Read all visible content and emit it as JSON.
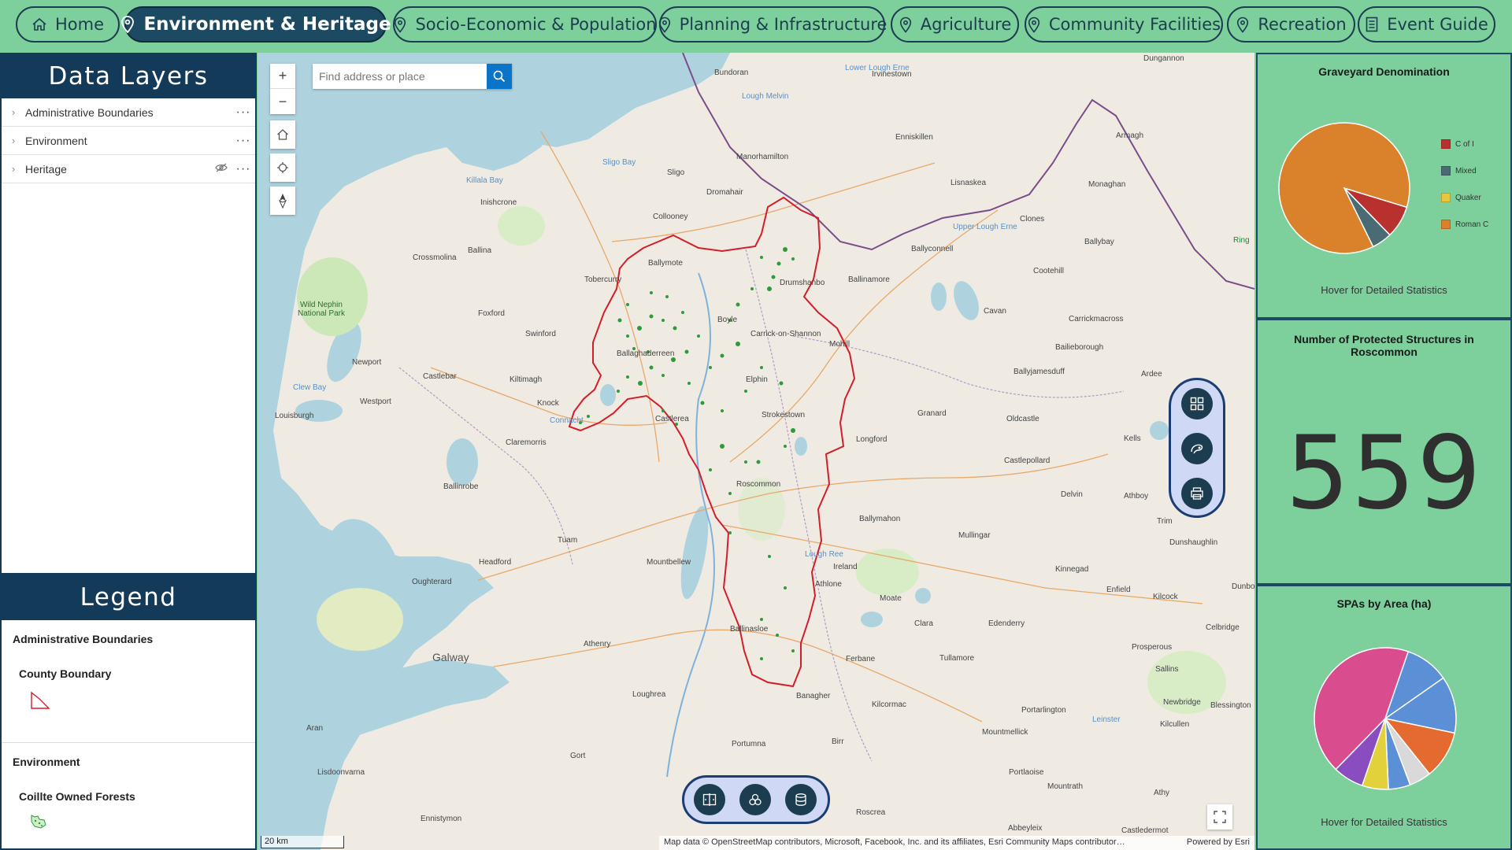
{
  "nav": {
    "tabs": [
      {
        "label": "Home",
        "icon": "home-icon",
        "active": false
      },
      {
        "label": "Environment & Heritage",
        "icon": "map-pin-icon",
        "active": true
      },
      {
        "label": "Socio-Economic & Population",
        "icon": "map-pin-icon",
        "active": false
      },
      {
        "label": "Planning & Infrastructure",
        "icon": "map-pin-icon",
        "active": false
      },
      {
        "label": "Agriculture",
        "icon": "map-pin-icon",
        "active": false
      },
      {
        "label": "Community Facilities",
        "icon": "map-pin-icon",
        "active": false
      },
      {
        "label": "Recreation",
        "icon": "map-pin-icon",
        "active": false
      },
      {
        "label": "Event Guide",
        "icon": "document-icon",
        "active": false
      }
    ]
  },
  "layers": {
    "title": "Data Layers",
    "items": [
      {
        "label": "Administrative Boundaries",
        "hidden": false
      },
      {
        "label": "Environment",
        "hidden": false
      },
      {
        "label": "Heritage",
        "hidden": true
      }
    ]
  },
  "legend": {
    "title": "Legend",
    "sections": [
      {
        "title": "Administrative Boundaries",
        "sublabel": "County Boundary"
      },
      {
        "title": "Environment",
        "sublabel": "Coillte Owned Forests"
      }
    ]
  },
  "map": {
    "search_placeholder": "Find address or place",
    "scale_label": "20 km",
    "attribution": "Map data © OpenStreetMap contributors, Microsoft, Facebook, Inc. and its affiliates, Esri Community Maps contributor…",
    "powered_by": "Powered by Esri",
    "place_labels": [
      "Bundoran",
      "Irvinestown",
      "Dungannon",
      "Lower Lough Erne",
      "Lough Melvin",
      "Enniskillen",
      "Armagh",
      "Sligo Bay",
      "Sligo",
      "Manorhamilton",
      "Killala Bay",
      "Inishcrone",
      "Dromahair",
      "Lisnaskea",
      "Monaghan",
      "Clones",
      "Upper Lough Erne",
      "Collooney",
      "Ballyconnell",
      "Ballybay",
      "Crossmolina",
      "Ballina",
      "Ballymote",
      "Cootehill",
      "Tobercurry",
      "Drumshanbo",
      "Ballinamore",
      "Wild Nephin National Park",
      "Foxford",
      "Carrick-on-Shannon",
      "Cavan",
      "Carrickmacross",
      "Swinford",
      "Boyle",
      "Mohill",
      "Newport",
      "Ballaghaderreen",
      "Bailieborough",
      "Castlebar",
      "Kiltimagh",
      "Elphin",
      "Ballyjamesduff",
      "Ardee",
      "Clew Bay",
      "Westport",
      "Knock",
      "Louisburgh",
      "Connacht",
      "Castlerea",
      "Strokestown",
      "Granard",
      "Oldcastle",
      "Claremorris",
      "Longford",
      "Kells",
      "Castlepollard",
      "Ballinrobe",
      "Roscommon",
      "Delvin",
      "Athboy",
      "Trim",
      "Ballymahon",
      "Tuam",
      "Mullingar",
      "Dunshaughlin",
      "Headford",
      "Mountbellew",
      "Lough Ree",
      "Ireland",
      "Kinnegad",
      "Oughterard",
      "Athlone",
      "Moate",
      "Enfield",
      "Kilcock",
      "Dunboyne",
      "Clara",
      "Edenderry",
      "Celbridge",
      "Athenry",
      "Ballinasloe",
      "Galway",
      "Ferbane",
      "Tullamore",
      "Prosperous",
      "Sallins",
      "Loughrea",
      "Banagher",
      "Kilcormac",
      "Portarlington",
      "Newbridge",
      "Blessington",
      "Leinster",
      "Kilcullen",
      "Aran",
      "Portumna",
      "Birr",
      "Mountmellick",
      "Gort",
      "Portlaoise",
      "Lisdoonvarna",
      "Mountrath",
      "Athy",
      "Ennistymon",
      "Roscrea",
      "Abbeyleix",
      "Castledermot",
      "Ring"
    ]
  },
  "charts": {
    "graveyard": {
      "title": "Graveyard Denomination",
      "note": "Hover for Detailed Statistics",
      "legend": [
        {
          "label": "C of I",
          "color": "#b8312f"
        },
        {
          "label": "Mixed",
          "color": "#4a6b73"
        },
        {
          "label": "Quaker",
          "color": "#e9c73a"
        },
        {
          "label": "Roman C",
          "color": "#d9822b"
        }
      ]
    },
    "protected": {
      "title": "Number of Protected Structures in Roscommon",
      "value": "559"
    },
    "spa": {
      "title": "SPAs by Area (ha)",
      "note": "Hover for Detailed Statistics"
    }
  },
  "chart_data": [
    {
      "type": "pie",
      "title": "Graveyard Denomination",
      "categories": [
        "C of I",
        "Mixed",
        "Quaker",
        "Roman C"
      ],
      "values": [
        8,
        5,
        0,
        87
      ],
      "colors": [
        "#b8312f",
        "#4a6b73",
        "#e9c73a",
        "#d9822b"
      ]
    },
    {
      "type": "pie",
      "title": "SPAs by Area (ha)",
      "values": [
        13,
        11,
        5,
        5,
        6,
        7,
        43,
        10
      ],
      "colors": [
        "#5b8fd6",
        "#e46a2f",
        "#d9d9d9",
        "#5b8fd6",
        "#e3d13b",
        "#8a4dbf",
        "#d94d8f",
        "#5b8fd6"
      ]
    }
  ]
}
